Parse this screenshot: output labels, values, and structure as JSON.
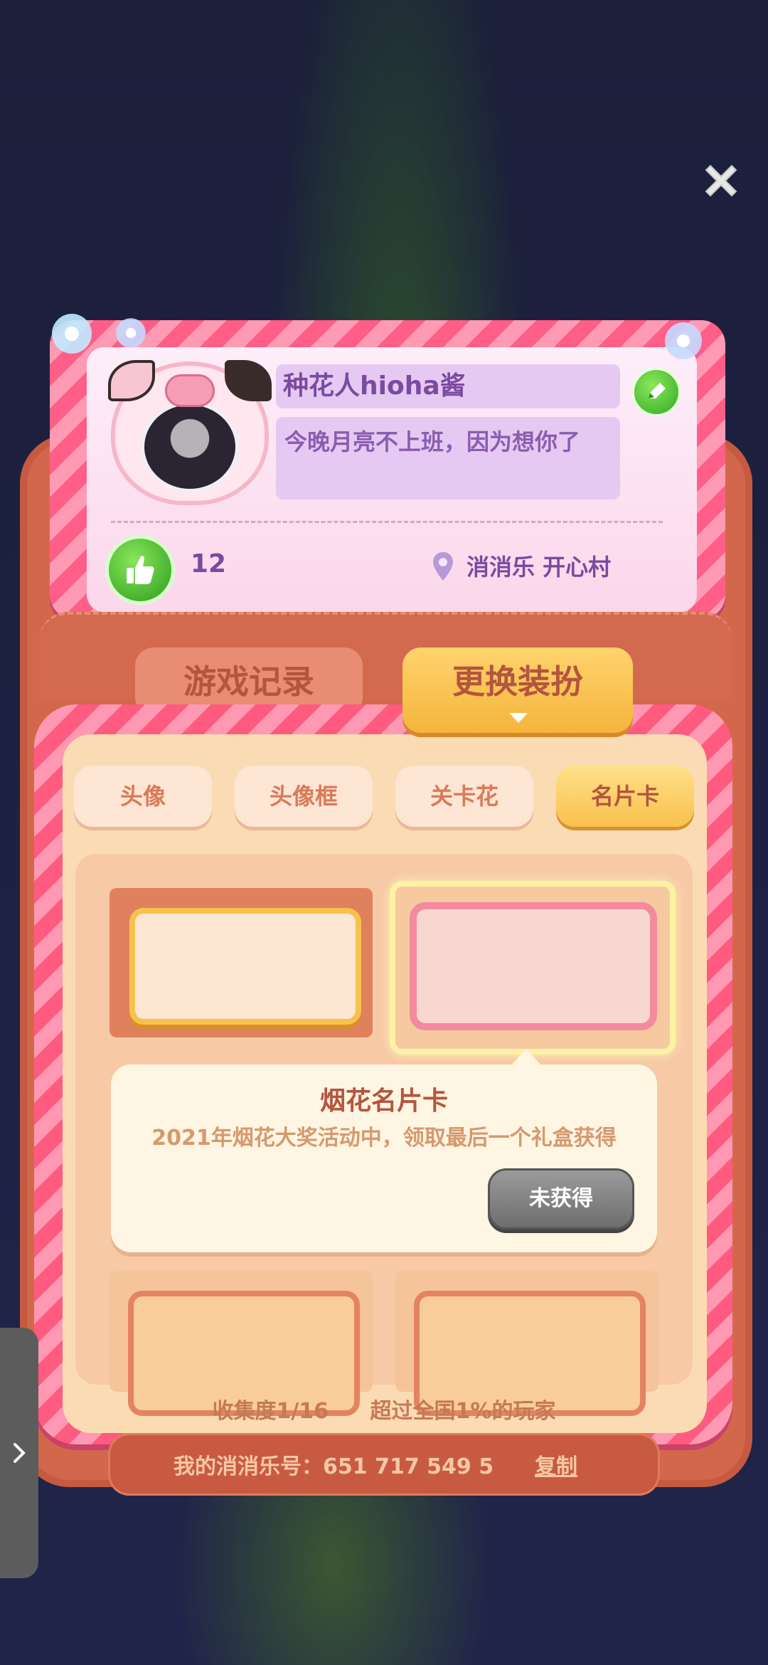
{
  "profile": {
    "name": "种花人hioha酱",
    "signature": "今晚月亮不上班，因为想你了",
    "likes": "12",
    "location": "消消乐  开心村"
  },
  "tabs": {
    "records": "游戏记录",
    "dress": "更换装扮"
  },
  "sub_tabs": [
    {
      "label": "头像"
    },
    {
      "label": "头像框"
    },
    {
      "label": "关卡花"
    },
    {
      "label": "名片卡"
    }
  ],
  "detail": {
    "title": "烟花名片卡",
    "description": "2021年烟花大奖活动中，领取最后一个礼盒获得",
    "status_button": "未获得"
  },
  "collection": {
    "progress": "收集度1/16",
    "rank": "超过全国1%的玩家"
  },
  "footer": {
    "id_text": "我的消消乐号：651 717 549 5",
    "copy": "复制"
  },
  "colors": {
    "accent_pink": "#ff5e86",
    "panel": "#fbdbb3",
    "text_brown": "#b4553e",
    "text_purple": "#7a4ba0"
  }
}
